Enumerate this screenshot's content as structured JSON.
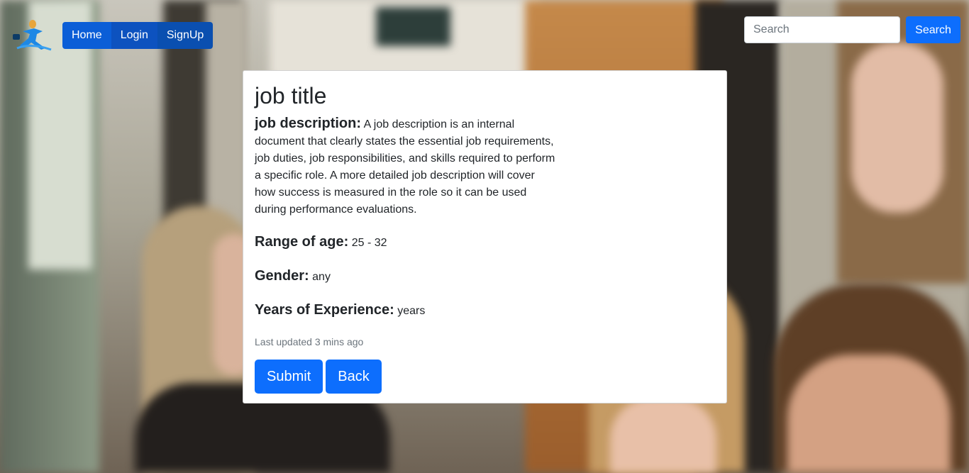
{
  "nav": {
    "logo_icon": "running-person-logo-icon",
    "items": [
      {
        "label": "Home"
      },
      {
        "label": "Login"
      },
      {
        "label": "SignUp"
      }
    ]
  },
  "search": {
    "placeholder": "Search",
    "value": "",
    "button_label": "Search"
  },
  "job": {
    "title": "job title",
    "description_label": "job description:",
    "description": "A job description is an internal document that clearly states the essential job requirements, job duties, job responsibilities, and skills required to perform a specific role. A more detailed job description will cover how success is measured in the role so it can be used during performance evaluations.",
    "age_label": "Range of age:",
    "age_value": "25 - 32",
    "gender_label": "Gender:",
    "gender_value": "any",
    "experience_label": "Years of Experience:",
    "experience_value": "years",
    "updated": "Last updated 3 mins ago",
    "submit_label": "Submit",
    "back_label": "Back"
  },
  "colors": {
    "primary": "#0d6efd",
    "nav_active": "#0b5ed7",
    "text": "#212529",
    "muted": "#6c757d"
  }
}
